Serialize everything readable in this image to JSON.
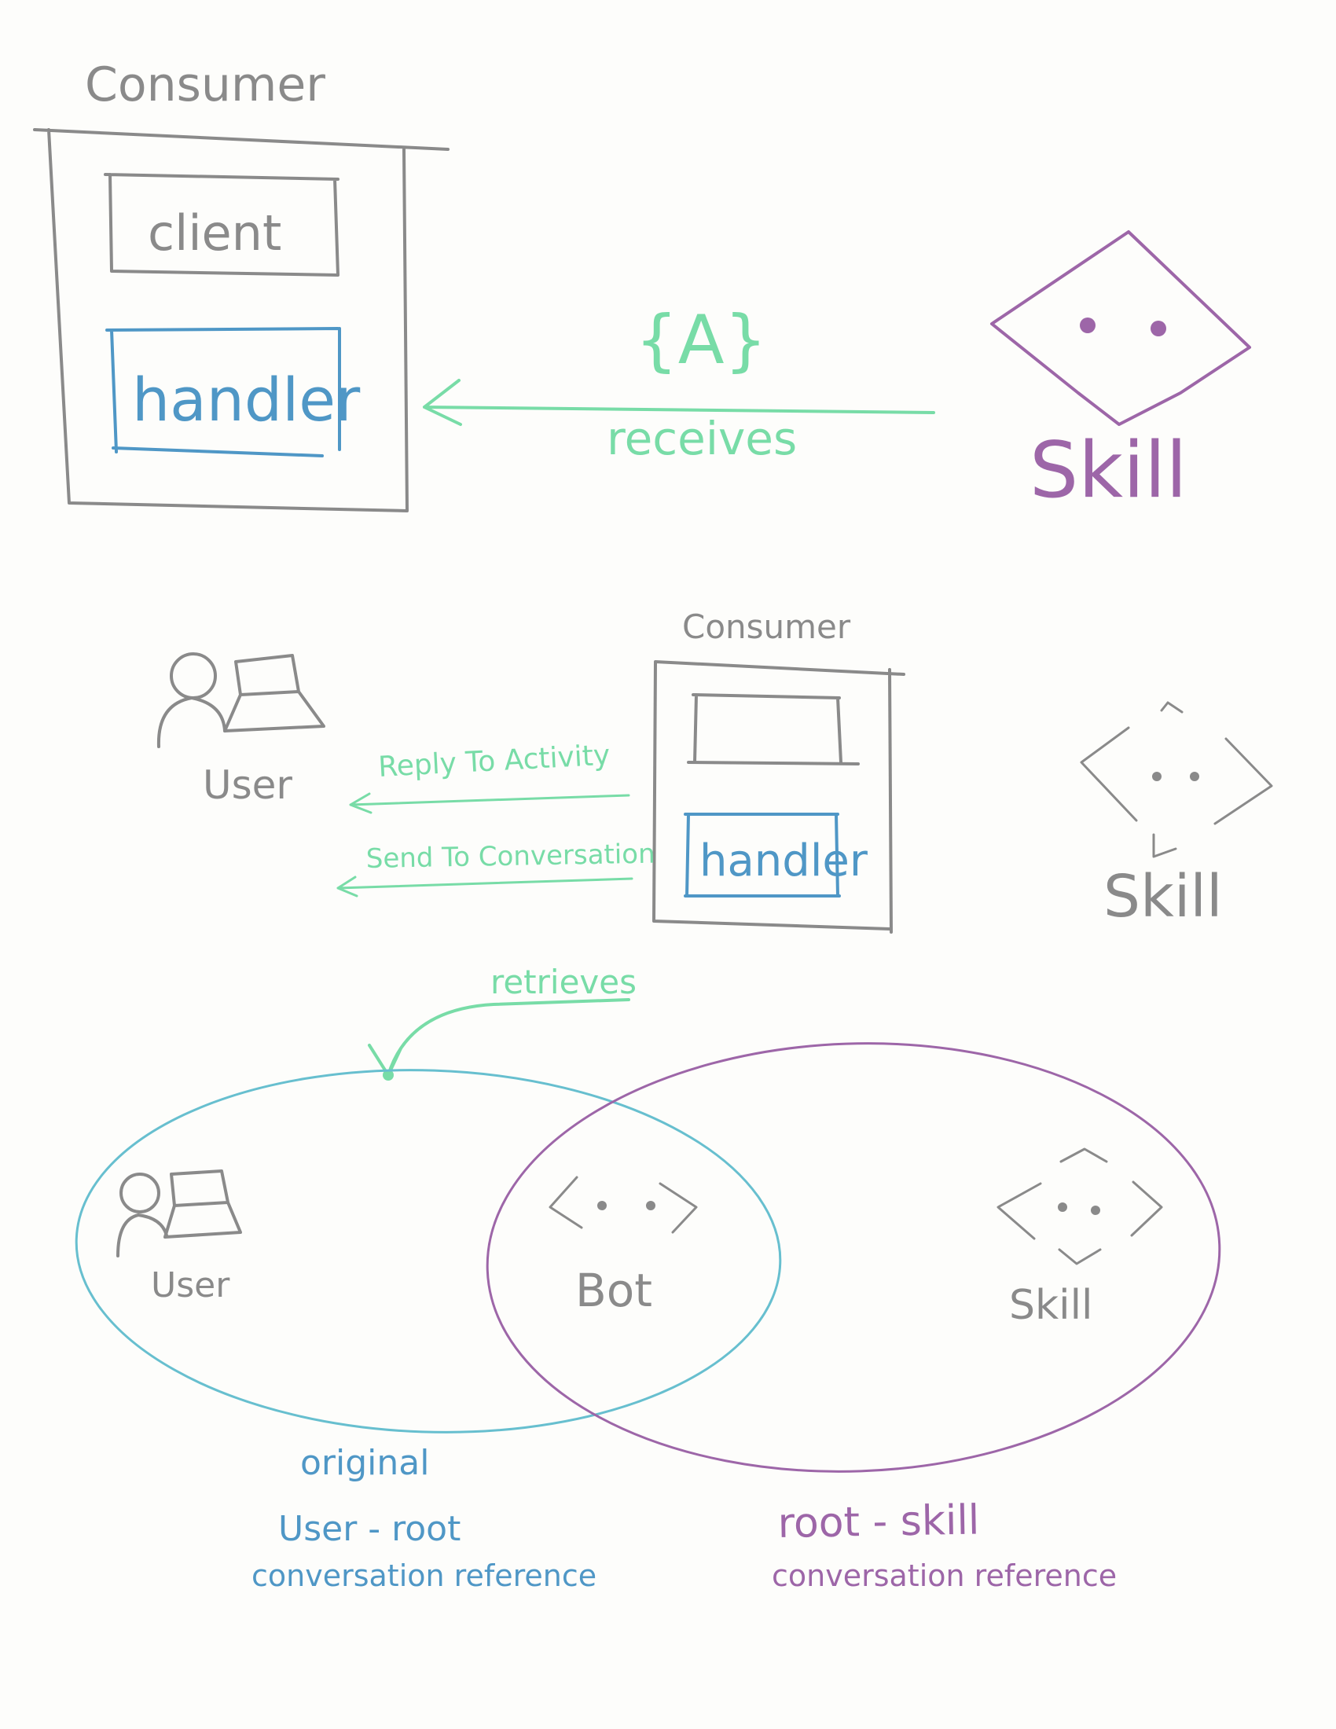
{
  "colors": {
    "gray": "#8a8a8a",
    "blue": "#4f97c6",
    "teal": "#67bfcf",
    "purple": "#9d66a8",
    "green": "#78dca7"
  },
  "diagram1": {
    "consumer_label": "Consumer",
    "client_label": "client",
    "handler_label": "handler",
    "activity_label": "{A}",
    "arrow_label": "receives",
    "skill_label": "Skill"
  },
  "diagram2": {
    "user_label": "User",
    "consumer_label": "Consumer",
    "handler_label": "handler",
    "arrow1_label": "Reply To Activity",
    "arrow2_label": "Send To Conversation",
    "skill_label": "Skill"
  },
  "diagram3": {
    "retrieves_label": "retrieves",
    "user_label": "User",
    "bot_label": "Bot",
    "skill_label": "Skill",
    "left_caption": [
      "original",
      "User - root",
      "conversation reference"
    ],
    "right_caption": [
      "root - skill",
      "conversation reference"
    ]
  }
}
